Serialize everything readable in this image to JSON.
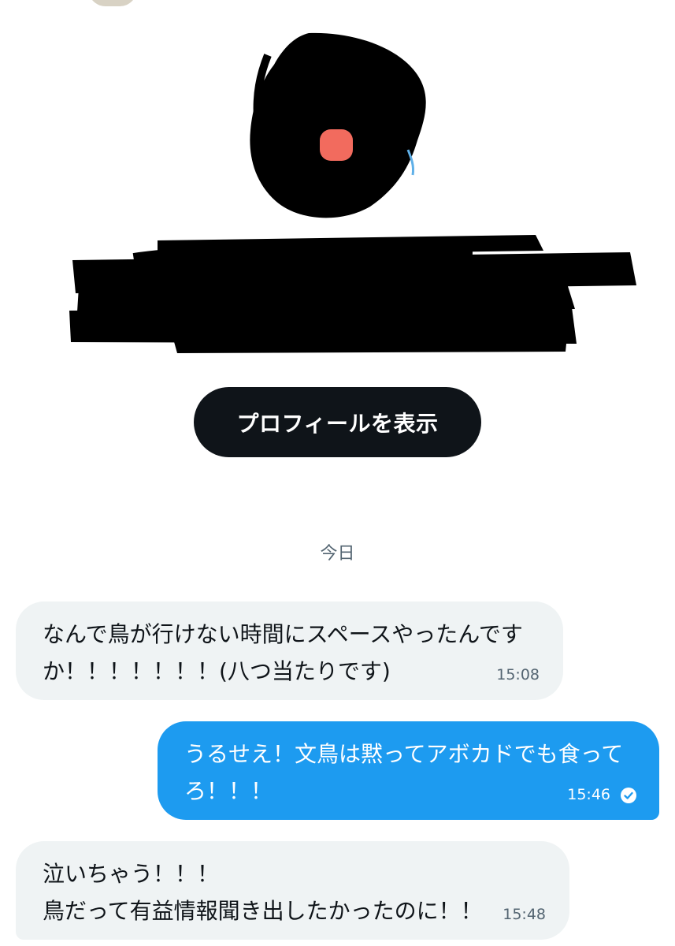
{
  "profile": {
    "view_profile_label": "プロフィールを表示"
  },
  "conversation": {
    "date_divider": "今日",
    "messages": [
      {
        "direction": "incoming",
        "text": "なんで鳥が行けない時間にスペースやったんです\nか！！！！！！！(八つ当たりです)",
        "time": "15:08"
      },
      {
        "direction": "outgoing",
        "text": "うるせえ！文鳥は黙ってアボカドでも食って\nろ！！！",
        "time": "15:46",
        "status_icon": "read-check-icon"
      },
      {
        "direction": "incoming",
        "text": "泣いちゃう！！！\n鳥だって有益情報聞き出したかったのに！！",
        "time": "15:48"
      }
    ]
  },
  "colors": {
    "accent": "#1d9bf0",
    "button_bg": "#0f1419",
    "incoming_bg": "#eff3f4",
    "muted_text": "#536471",
    "redaction": "#000000"
  }
}
